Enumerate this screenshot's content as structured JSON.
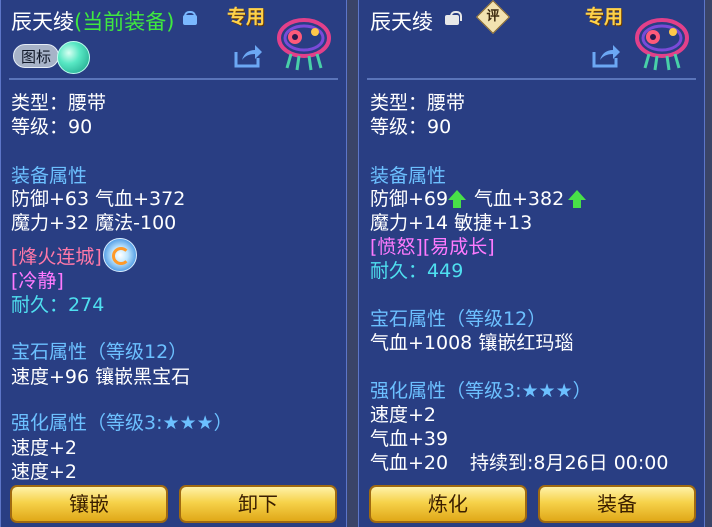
{
  "left": {
    "title": "辰天绫",
    "title_status": "(当前装备)",
    "exclusive": "专用",
    "badge": "图标",
    "type_label": "类型：",
    "type_value": "腰带",
    "level_label": "等级：",
    "level_value": "90",
    "attr_header": "装备属性",
    "attr1": "防御+63 气血+372",
    "attr2": "魔力+32 魔法-100",
    "special_skill": "[烽火连城]",
    "special_effect": "[冷静]",
    "durability_label": "耐久：",
    "durability_value": "274",
    "gem_header": "宝石属性",
    "gem_level": "（等级12）",
    "gem_line": "速度+96 镶嵌黑宝石",
    "enhance_header": "强化属性",
    "enhance_level": "（等级3:★★★）",
    "enhance1": "速度+2",
    "enhance2": "速度+2",
    "buttons": [
      "镶嵌",
      "卸下"
    ]
  },
  "right": {
    "title": "辰天绫",
    "appraise": "评",
    "exclusive": "专用",
    "type_label": "类型：",
    "type_value": "腰带",
    "level_label": "等级：",
    "level_value": "90",
    "attr_header": "装备属性",
    "attr1a": "防御+69",
    "attr1b": "气血+382",
    "attr2": "魔力+14 敏捷+13",
    "effects": "[愤怒][易成长]",
    "durability_label": "耐久：",
    "durability_value": "449",
    "gem_header": "宝石属性",
    "gem_level": "（等级12）",
    "gem_line": "气血+1008 镶嵌红玛瑙",
    "enhance_header": "强化属性",
    "enhance_level": "（等级3:★★★）",
    "enhance1": "速度+2",
    "enhance2": "气血+39",
    "enhance3": "气血+20",
    "enhance3_duration": "持续到:8月26日 00:00",
    "buttons": [
      "炼化",
      "装备"
    ]
  },
  "colors": {
    "panel": "#28408c",
    "section_header": "#6cc0ff",
    "status_green": "#3fe83f",
    "red_effect": "#ff78a8",
    "purple_effect": "#ff7aff",
    "durability": "#4fe0f0",
    "exclusive": "#ffd24a",
    "button": "#f6d24a"
  },
  "icons": [
    "lock-icon",
    "unlock-icon",
    "share-icon",
    "belt-item-icon",
    "orb-icon",
    "skill-icon",
    "up-arrow-icon",
    "appraise-icon"
  ]
}
